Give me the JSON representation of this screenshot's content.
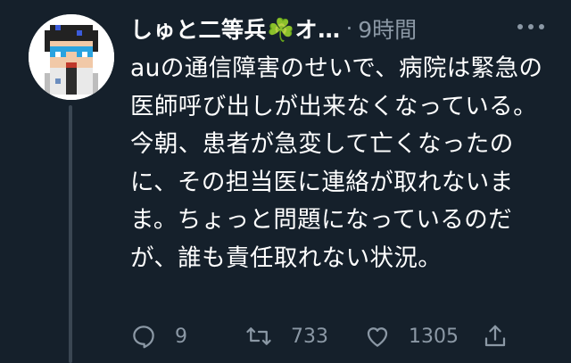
{
  "tweet": {
    "author_name": "しゅと二等兵☘️オ…",
    "separator": "·",
    "time": "9時間",
    "text": "auの通信障害のせいで、病院は緊急の医師呼び出しが出来なくなっている。今朝、患者が急変して亡くなったのに、その担当医に連絡が取れないまま。ちょっと問題になっているのだが、誰も責任取れない状況。"
  },
  "actions": {
    "reply_count": "9",
    "retweet_count": "733",
    "like_count": "1305"
  },
  "icons": {
    "avatar": "pixel-art-character-avatar",
    "more": "more-dots-icon",
    "reply": "reply-icon",
    "retweet": "retweet-icon",
    "like": "heart-icon",
    "share": "share-icon"
  },
  "colors": {
    "background": "#15202b",
    "secondary_text": "#8b98a5",
    "primary_text": "#ffffff"
  }
}
